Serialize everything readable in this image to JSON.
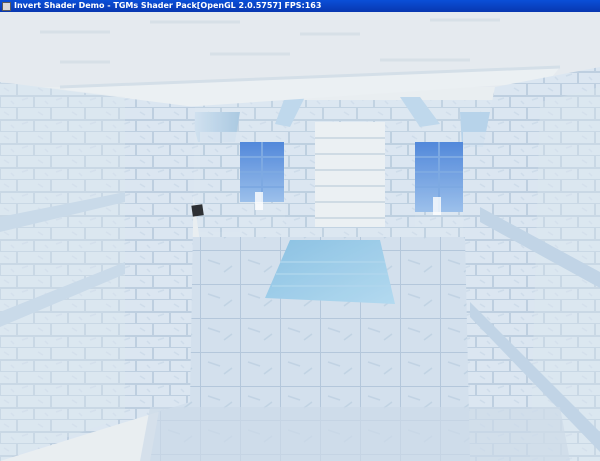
{
  "window": {
    "title": "Invert Shader Demo - TGMs Shader Pack[OpenGL 2.0.5757] FPS:163"
  },
  "scene": {
    "effect": "inverted colors",
    "palette": {
      "ceiling": "#e4eaee",
      "wall": "#d4e2ee",
      "mortar": "#b9cde0",
      "blue_glow": "#2c6fd0",
      "floor": "#c9d9e7",
      "water": "#8fc6e4"
    },
    "objects": [
      "stone-corridor",
      "blue-windows",
      "water-pool",
      "staircase",
      "dark-cube"
    ]
  }
}
